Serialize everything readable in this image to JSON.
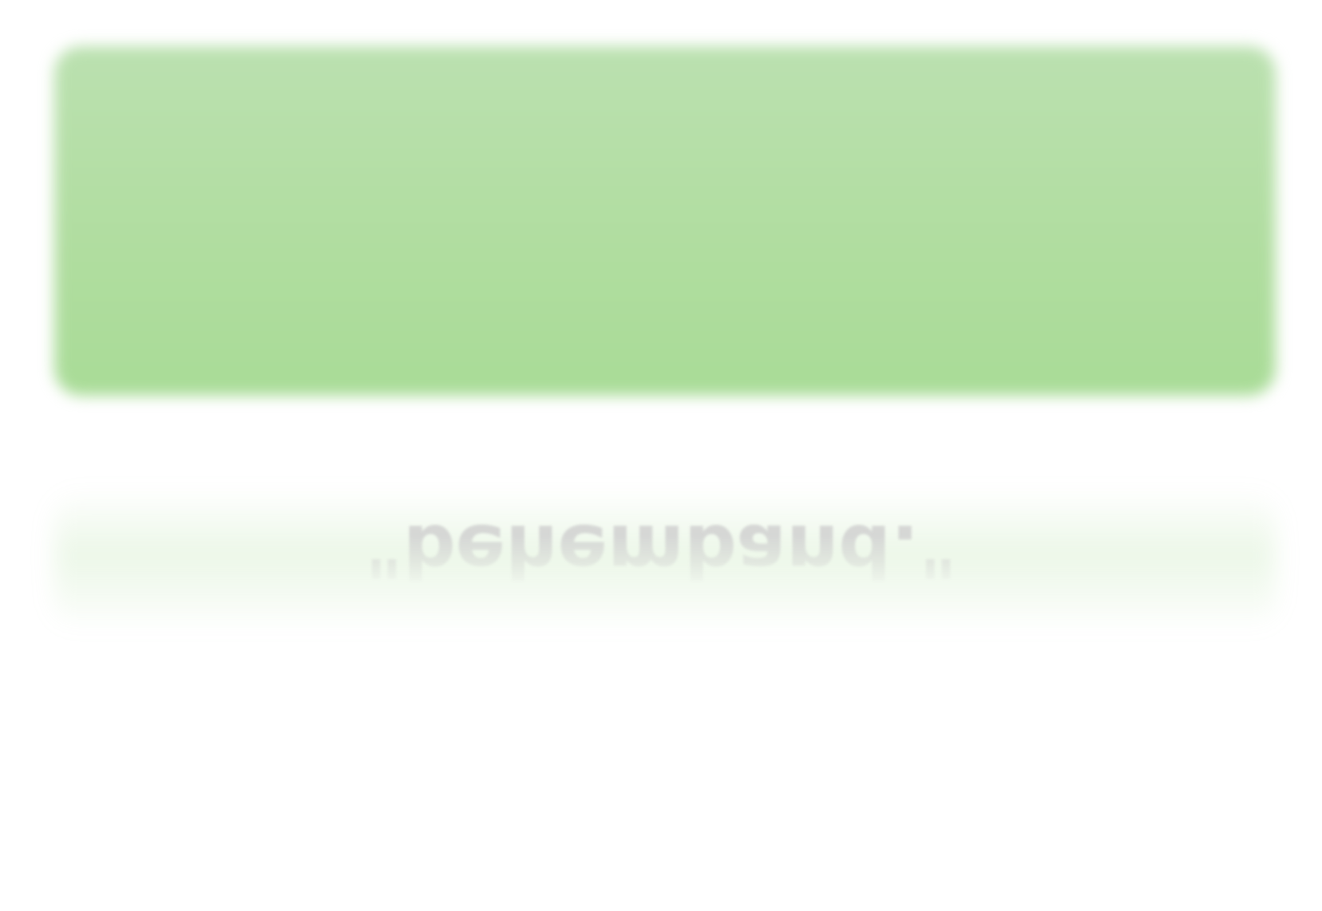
{
  "reflection": {
    "text": "\"behemband.\""
  },
  "colors": {
    "banner_top": "#bbe1b0",
    "banner_bottom": "#a9dc97",
    "reflection_text": "#cfcfcf",
    "background": "#ffffff"
  }
}
